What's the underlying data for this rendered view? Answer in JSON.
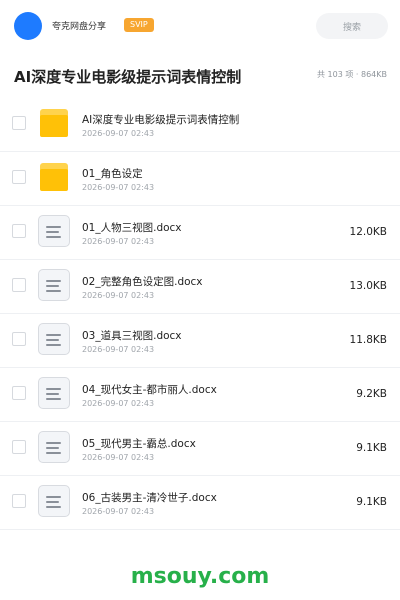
{
  "header": {
    "brand": "夸克网盘分享",
    "svip_badge": "SVIP",
    "search_placeholder": "搜索"
  },
  "titlebar": {
    "title": "AI深度专业电影级提示词表情控制",
    "stats": "共 103 项 · 864KB"
  },
  "files": [
    {
      "name": "AI深度专业电影级提示词表情控制",
      "date": "2026-09-07 02:43",
      "size": "",
      "type": "folder"
    },
    {
      "name": "01_角色设定",
      "date": "2026-09-07 02:43",
      "size": "",
      "type": "folder"
    },
    {
      "name": "01_人物三视图.docx",
      "date": "2026-09-07 02:43",
      "size": "12.0KB",
      "type": "docx"
    },
    {
      "name": "02_完整角色设定图.docx",
      "date": "2026-09-07 02:43",
      "size": "13.0KB",
      "type": "docx"
    },
    {
      "name": "03_道具三视图.docx",
      "date": "2026-09-07 02:43",
      "size": "11.8KB",
      "type": "docx"
    },
    {
      "name": "04_现代女主-都市丽人.docx",
      "date": "2026-09-07 02:43",
      "size": "9.2KB",
      "type": "docx"
    },
    {
      "name": "05_现代男主-霸总.docx",
      "date": "2026-09-07 02:43",
      "size": "9.1KB",
      "type": "docx"
    },
    {
      "name": "06_古装男主-清冷世子.docx",
      "date": "2026-09-07 02:43",
      "size": "9.1KB",
      "type": "docx"
    }
  ],
  "footer": {
    "watermark": "msouy.com"
  },
  "colors": {
    "accent_blue": "#1e7bff",
    "svip_orange": "#f7a630",
    "folder_yellow": "#ffc107",
    "watermark_green": "#27b04a"
  },
  "icons": {
    "folder": "folder-icon",
    "docx": "document-icon"
  }
}
